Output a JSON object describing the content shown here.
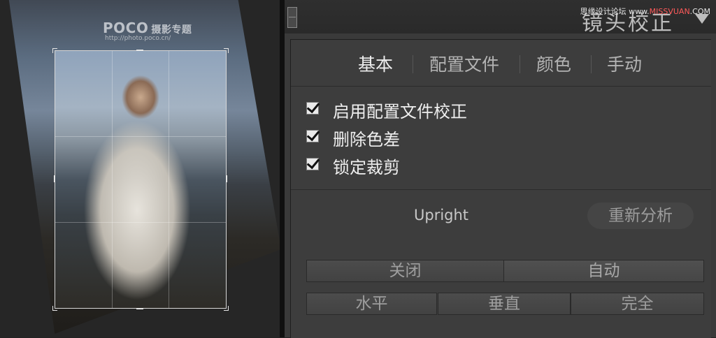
{
  "watermark": {
    "logo": "POCO",
    "logo_sub": "摄影专题",
    "url": "http://photo.poco.cn/"
  },
  "site_mark": {
    "prefix": "思缘设计论坛 ",
    "www": "www.",
    "highlight": "MISSVUAN",
    "suffix": ".COM"
  },
  "panel": {
    "title": "镜头校正",
    "tabs": [
      "基本",
      "配置文件",
      "颜色",
      "手动"
    ],
    "active_tab": "基本",
    "checkboxes": [
      {
        "label": "启用配置文件校正",
        "checked": true
      },
      {
        "label": "删除色差",
        "checked": true
      },
      {
        "label": "锁定裁剪",
        "checked": true
      }
    ],
    "upright": {
      "label": "Upright",
      "reanalyze_label": "重新分析",
      "row1": [
        "关闭",
        "自动"
      ],
      "row2": [
        "水平",
        "垂直",
        "完全"
      ]
    }
  },
  "colors": {
    "panel_bg": "#3d3d3d",
    "text_light": "#efefef",
    "text_dim": "#9e9e9e",
    "checkbox": "#e9e9e9"
  }
}
